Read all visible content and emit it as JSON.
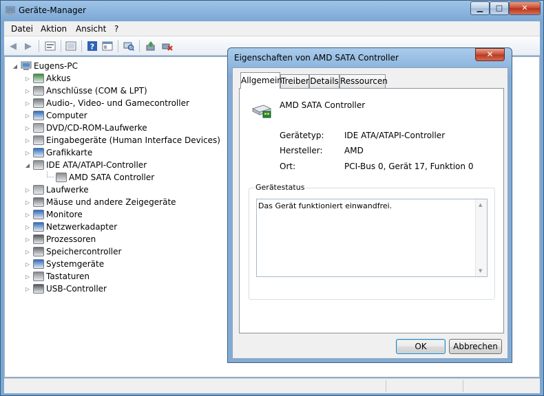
{
  "window": {
    "title": "Geräte-Manager"
  },
  "menu": [
    "Datei",
    "Aktion",
    "Ansicht",
    "?"
  ],
  "tree": {
    "root": "Eugens-PC",
    "items": [
      {
        "label": "Akkus",
        "icon": "battery-icon",
        "color": "#3f8f3a"
      },
      {
        "label": "Anschlüsse (COM & LPT)",
        "icon": "port-icon",
        "color": "#8a8a8a"
      },
      {
        "label": "Audio-, Video- und Gamecontroller",
        "icon": "speaker-icon",
        "color": "#777777"
      },
      {
        "label": "Computer",
        "icon": "computer-icon",
        "color": "#2f6cc0"
      },
      {
        "label": "DVD/CD-ROM-Laufwerke",
        "icon": "disc-drive-icon",
        "color": "#9a9a9a"
      },
      {
        "label": "Eingabegeräte (Human Interface Devices)",
        "icon": "hid-icon",
        "color": "#8a8a8a"
      },
      {
        "label": "Grafikkarte",
        "icon": "display-adapter-icon",
        "color": "#2a6fc8"
      },
      {
        "label": "IDE ATA/ATAPI-Controller",
        "icon": "ide-controller-icon",
        "color": "#8c8c8c",
        "expanded": true
      },
      {
        "label": "AMD SATA Controller",
        "icon": "sata-controller-icon",
        "color": "#8c8c8c",
        "child": true
      },
      {
        "label": "Laufwerke",
        "icon": "disk-drive-icon",
        "color": "#9a9a9a"
      },
      {
        "label": "Mäuse und andere Zeigegeräte",
        "icon": "mouse-icon",
        "color": "#707070"
      },
      {
        "label": "Monitore",
        "icon": "monitor-icon",
        "color": "#2f6cc0"
      },
      {
        "label": "Netzwerkadapter",
        "icon": "network-icon",
        "color": "#2f6cc0"
      },
      {
        "label": "Prozessoren",
        "icon": "processor-icon",
        "color": "#555555"
      },
      {
        "label": "Speichercontroller",
        "icon": "storage-controller-icon",
        "color": "#6a6a6a"
      },
      {
        "label": "Systemgeräte",
        "icon": "system-devices-icon",
        "color": "#2f6cc0"
      },
      {
        "label": "Tastaturen",
        "icon": "keyboard-icon",
        "color": "#8a8a8a"
      },
      {
        "label": "USB-Controller",
        "icon": "usb-icon",
        "color": "#555555"
      }
    ]
  },
  "dialog": {
    "title": "Eigenschaften von AMD SATA Controller",
    "tabs": [
      "Allgemein",
      "Treiber",
      "Details",
      "Ressourcen"
    ],
    "device_name": "AMD SATA Controller",
    "props": [
      {
        "label": "Gerätetyp:",
        "value": "IDE ATA/ATAPI-Controller"
      },
      {
        "label": "Hersteller:",
        "value": "AMD"
      },
      {
        "label": "Ort:",
        "value": "PCI-Bus 0, Gerät 17, Funktion 0"
      }
    ],
    "status_group": "Gerätestatus",
    "status_text": "Das Gerät funktioniert einwandfrei.",
    "ok": "OK",
    "cancel": "Abbrechen"
  }
}
